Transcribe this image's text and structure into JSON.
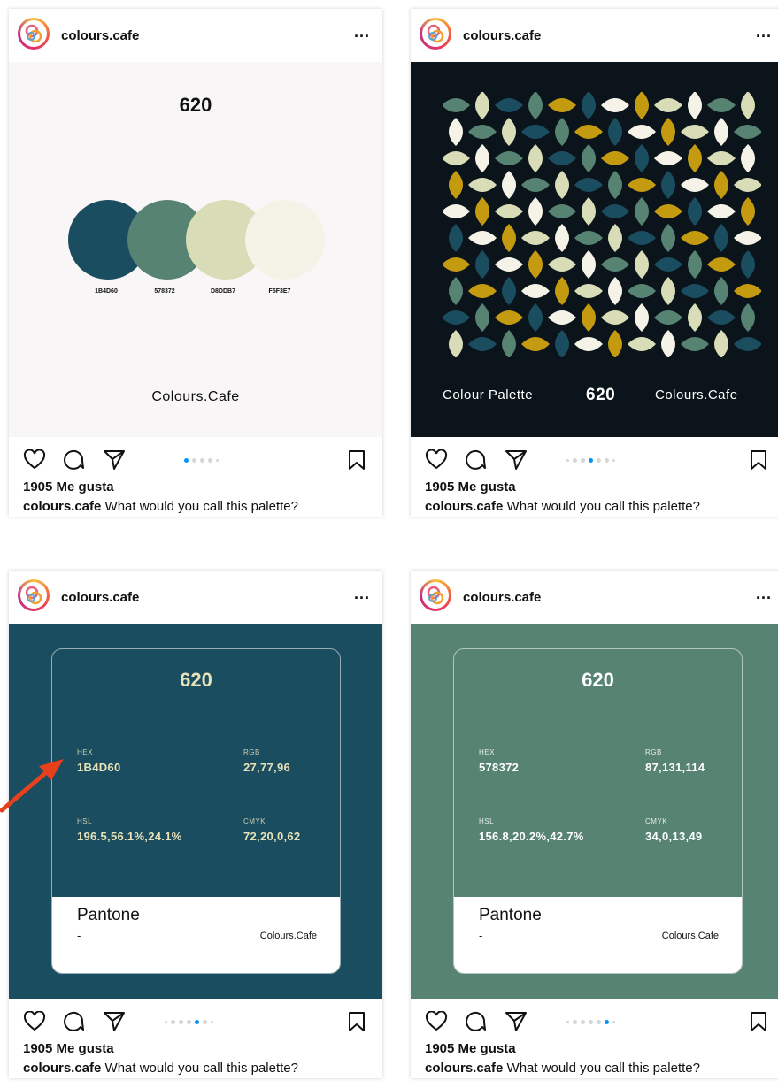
{
  "username": "colours.cafe",
  "more_label": "...",
  "likes": "1905 Me gusta",
  "caption_user": "colours.cafe",
  "caption_text": " What would you call this palette?",
  "palette_number": "620",
  "brand": "Colours.Cafe",
  "palette": [
    {
      "hex": "1B4D60",
      "color": "#1b4d60"
    },
    {
      "hex": "578372",
      "color": "#578372"
    },
    {
      "hex": "D8DDB7",
      "color": "#d8ddb7"
    },
    {
      "hex": "F5F3E7",
      "color": "#f5f3e7"
    }
  ],
  "pattern_caption": "Colour Palette",
  "pattern_colors": [
    "#1b4d60",
    "#578372",
    "#d8ddb7",
    "#f5f3e7",
    "#c49a10"
  ],
  "carousel_active": [
    0,
    2,
    3,
    4
  ],
  "detail_cards": [
    {
      "bg": "#1b4d60",
      "hex_label": "HEX",
      "hex": "1B4D60",
      "rgb_label": "RGB",
      "rgb": "27,77,96",
      "hsl_label": "HSL",
      "hsl": "196.5,56.1%,24.1%",
      "cmyk_label": "CMYK",
      "cmyk": "72,20,0,62",
      "text_color": "#e8e2b8",
      "pantone": "Pantone",
      "pantone_value": "-"
    },
    {
      "bg": "#578372",
      "hex_label": "HEX",
      "hex": "578372",
      "rgb_label": "RGB",
      "rgb": "87,131,114",
      "hsl_label": "HSL",
      "hsl": "156.8,20.2%,42.7%",
      "cmyk_label": "CMYK",
      "cmyk": "34,0,13,49",
      "text_color": "#ffffff",
      "pantone": "Pantone",
      "pantone_value": "-"
    }
  ],
  "icons": [
    "heart-icon",
    "comment-icon",
    "share-icon",
    "bookmark-icon",
    "arrow-annotation"
  ],
  "accent": "#0095f6",
  "arrow_color": "#e8401c"
}
